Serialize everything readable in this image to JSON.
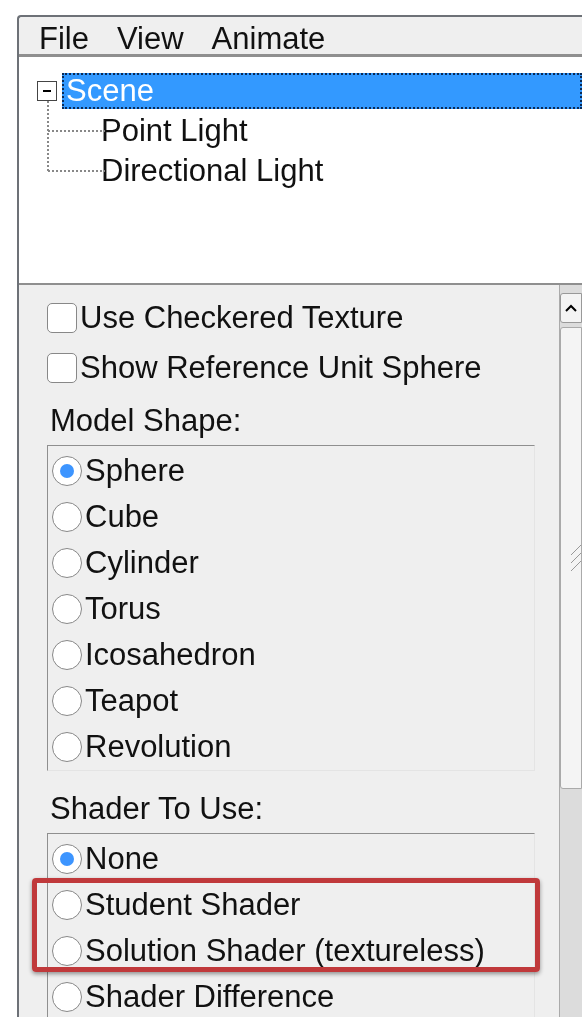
{
  "menu": [
    "File",
    "View",
    "Animate"
  ],
  "tree": [
    {
      "label": "Scene",
      "selected": true,
      "expanded": true,
      "children": [
        {
          "label": "Point Light",
          "selected": false
        },
        {
          "label": "Directional Light",
          "selected": false
        }
      ]
    }
  ],
  "options": [
    {
      "label": "Use Checkered Texture",
      "checked": false
    },
    {
      "label": "Show Reference Unit Sphere",
      "checked": false
    }
  ],
  "groups": [
    {
      "title": "Model Shape:",
      "items": [
        {
          "label": "Sphere",
          "selected": true,
          "highlighted": false
        },
        {
          "label": "Cube",
          "selected": false,
          "highlighted": false
        },
        {
          "label": "Cylinder",
          "selected": false,
          "highlighted": false
        },
        {
          "label": "Torus",
          "selected": false,
          "highlighted": false
        },
        {
          "label": "Icosahedron",
          "selected": false,
          "highlighted": false
        },
        {
          "label": "Teapot",
          "selected": false,
          "highlighted": false
        },
        {
          "label": "Revolution",
          "selected": false,
          "highlighted": false
        }
      ]
    },
    {
      "title": "Shader To Use:",
      "items": [
        {
          "label": "None",
          "selected": true,
          "highlighted": false
        },
        {
          "label": "Student Shader",
          "selected": false,
          "highlighted": true
        },
        {
          "label": "Solution Shader (textureless)",
          "selected": false,
          "highlighted": true
        },
        {
          "label": "Shader Difference",
          "selected": false,
          "highlighted": false
        }
      ]
    }
  ]
}
